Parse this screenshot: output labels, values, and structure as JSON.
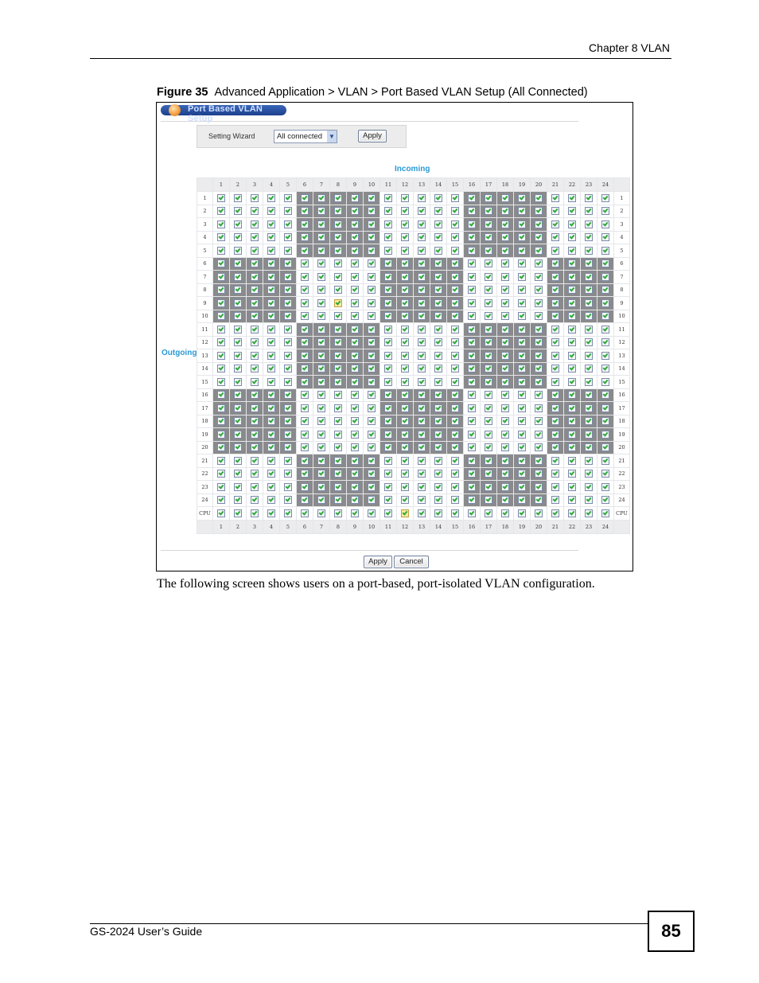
{
  "header": {
    "chapter": "Chapter 8 VLAN"
  },
  "caption": {
    "label": "Figure 35",
    "text": "Advanced Application > VLAN > Port Based VLAN Setup (All Connected)"
  },
  "screen": {
    "title": "Port Based VLAN Setup",
    "wizard": {
      "label": "Setting Wizard",
      "selected": "All connected",
      "apply_label": "Apply"
    },
    "incoming_label": "Incoming",
    "outgoing_label": "Outgoing",
    "columns": [
      "1",
      "2",
      "3",
      "4",
      "5",
      "6",
      "7",
      "8",
      "9",
      "10",
      "11",
      "12",
      "13",
      "14",
      "15",
      "16",
      "17",
      "18",
      "19",
      "20",
      "21",
      "22",
      "23",
      "24"
    ],
    "rows": [
      "1",
      "2",
      "3",
      "4",
      "5",
      "6",
      "7",
      "8",
      "9",
      "10",
      "11",
      "12",
      "13",
      "14",
      "15",
      "16",
      "17",
      "18",
      "19",
      "20",
      "21",
      "22",
      "23",
      "24",
      "CPU"
    ],
    "all_checked": true,
    "highlighted_cells": [
      {
        "row": "9",
        "col": "8"
      },
      {
        "row": "CPU",
        "col": "12"
      }
    ],
    "apply_label": "Apply",
    "cancel_label": "Cancel"
  },
  "body_text": "The following screen shows users on a port-based, port-isolated VLAN configuration.",
  "footer": {
    "guide": "GS-2024 User’s Guide",
    "page": "85"
  }
}
